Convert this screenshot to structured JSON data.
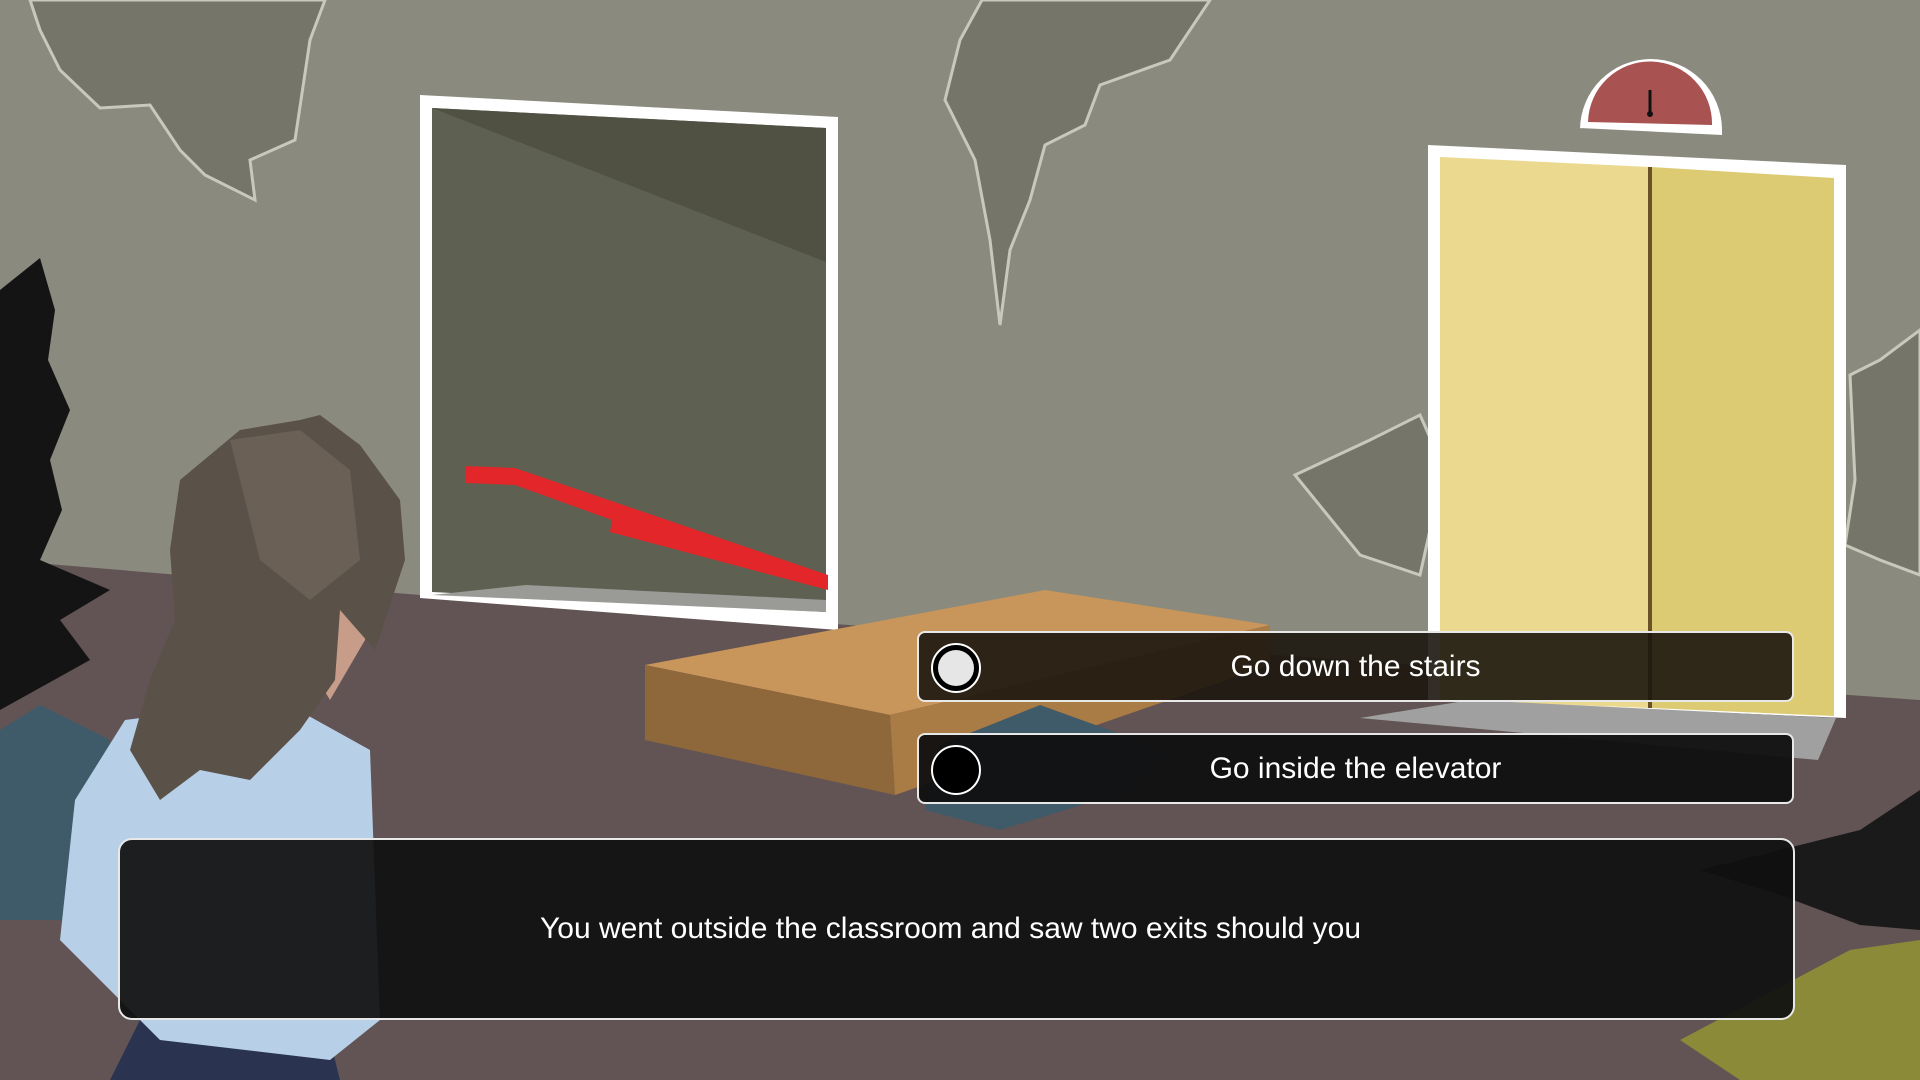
{
  "choices": [
    {
      "label": "Go down the stairs",
      "selected": true
    },
    {
      "label": "Go inside the elevator",
      "selected": false
    }
  ],
  "dialogue": {
    "text": "You went outside the classroom and saw two exits should you"
  },
  "scene": {
    "icons": [
      "stairwell-doorway-icon",
      "elevator-door-icon",
      "floor-indicator-gauge-icon",
      "player-character-icon",
      "fallen-wooden-board-icon"
    ],
    "colors": {
      "wall": "#8a8a7e",
      "floor": "#625454",
      "elevator_door": "#ead98f",
      "floor_indicator": "#a85252",
      "handrail": "#e3262a",
      "dialogue_bg": "#101010"
    }
  }
}
